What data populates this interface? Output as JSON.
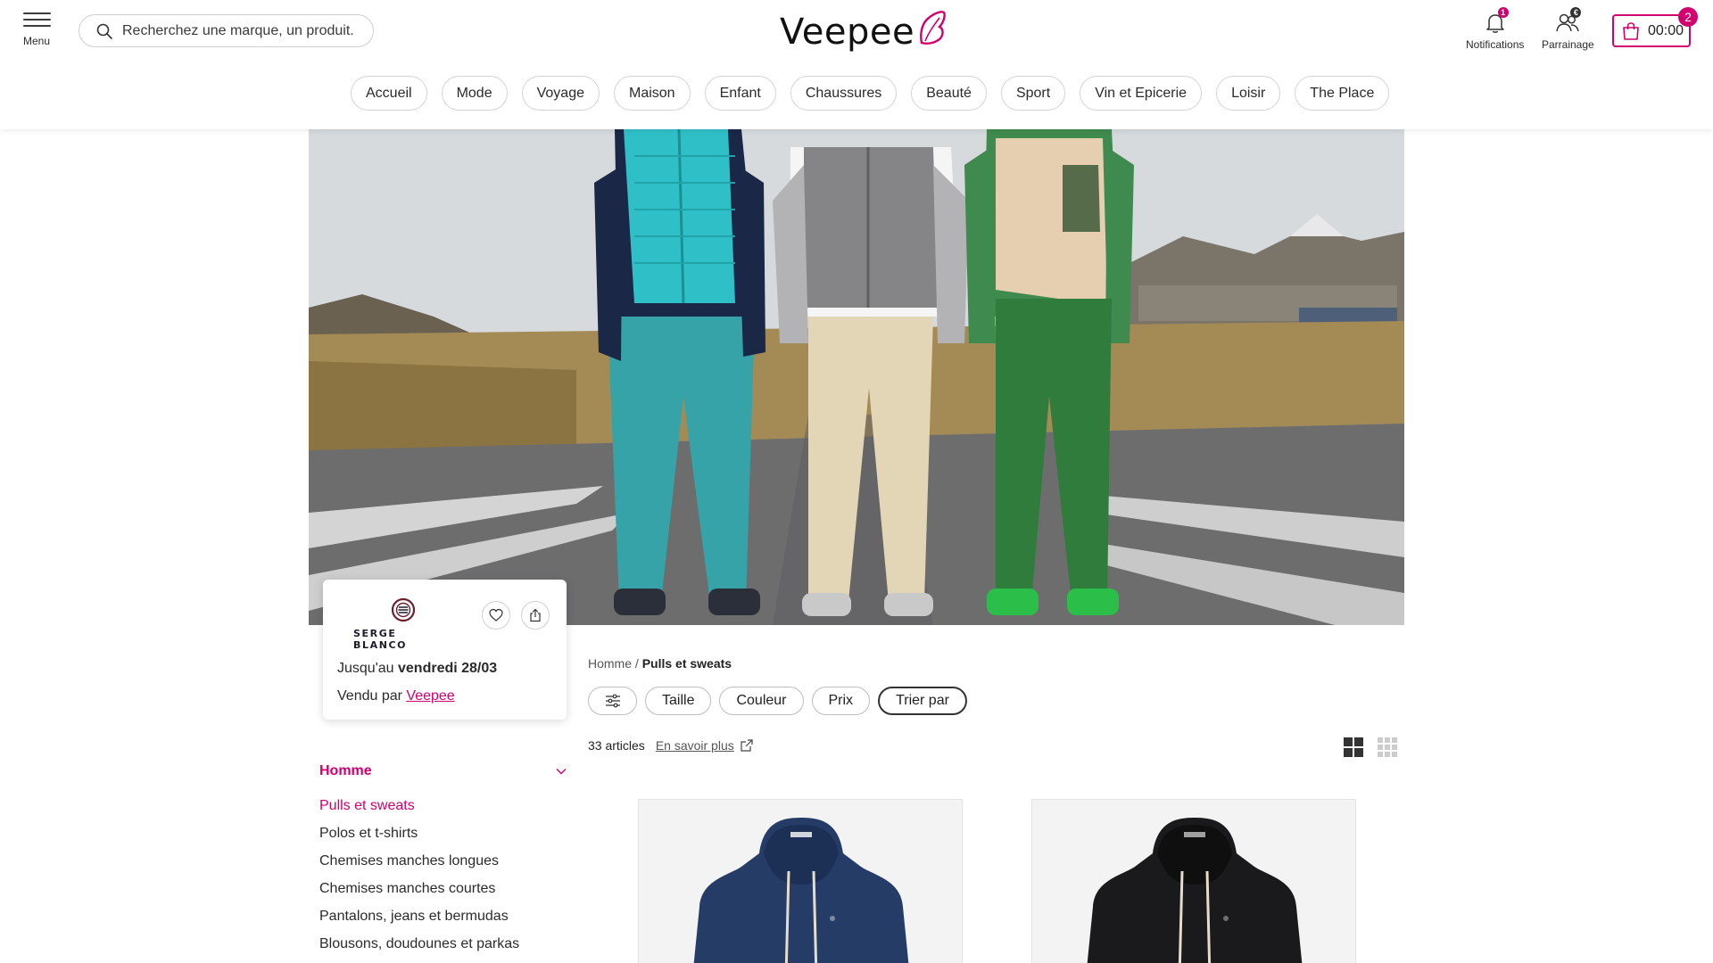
{
  "header": {
    "menu_label": "Menu",
    "search_placeholder": "Recherchez une marque, un produit...",
    "logo_text": "Veepee",
    "notifications_label": "Notifications",
    "notifications_count": "1",
    "referral_label": "Parrainage",
    "referral_count": "€",
    "cart_time": "00:00",
    "cart_count": "2",
    "accent_color": "#d1006e"
  },
  "nav": {
    "items": [
      "Accueil",
      "Mode",
      "Voyage",
      "Maison",
      "Enfant",
      "Chaussures",
      "Beauté",
      "Sport",
      "Vin et Epicerie",
      "Loisir",
      "The Place"
    ]
  },
  "brand": {
    "name": "SERGE BLANCO",
    "until_prefix": "Jusqu'au",
    "until_date": "vendredi 28/03",
    "sold_prefix": "Vendu par",
    "sold_by": "Veepee"
  },
  "sidebar": {
    "category": "Homme",
    "items": [
      "Pulls et sweats",
      "Polos et t-shirts",
      "Chemises manches longues",
      "Chemises manches courtes",
      "Pantalons, jeans et bermudas",
      "Blousons, doudounes et parkas"
    ],
    "active_index": 0
  },
  "main": {
    "breadcrumb_root": "Homme",
    "breadcrumb_sep": "/",
    "breadcrumb_current": "Pulls et sweats",
    "filters": [
      "Taille",
      "Couleur",
      "Prix",
      "Trier par"
    ],
    "count_text": "33 articles",
    "learn_more": "En savoir plus"
  },
  "products": [
    {
      "color": "navy"
    },
    {
      "color": "black"
    }
  ]
}
